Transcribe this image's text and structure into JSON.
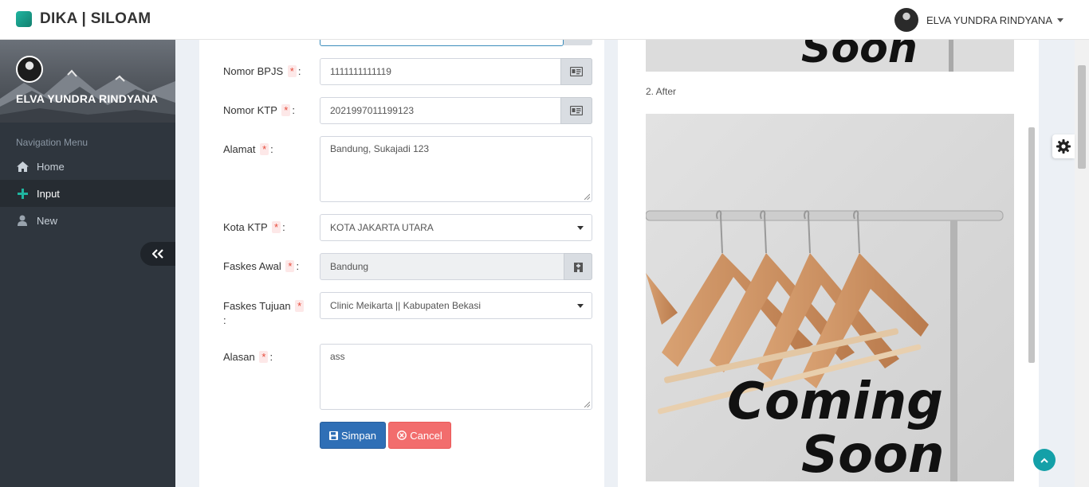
{
  "header": {
    "brand": "DIKA | SILOAM",
    "user_name": "ELVA YUNDRA RINDYANA"
  },
  "sidebar": {
    "user_name": "ELVA YUNDRA RINDYANA",
    "nav_title": "Navigation Menu",
    "items": [
      {
        "label": "Home",
        "icon": "home-icon"
      },
      {
        "label": "Input",
        "icon": "plus-icon",
        "active": true
      },
      {
        "label": "New",
        "icon": "user-icon"
      }
    ]
  },
  "form": {
    "required_mark": "*",
    "colon": ":",
    "bpjs": {
      "label": "Nomor BPJS",
      "value": "1111111111119"
    },
    "ktp": {
      "label": "Nomor KTP",
      "value": "2021997011199123"
    },
    "alamat": {
      "label": "Alamat",
      "value": "Bandung, Sukajadi 123"
    },
    "kota": {
      "label": "Kota KTP",
      "value": "KOTA JAKARTA UTARA"
    },
    "faskes_awal": {
      "label": "Faskes Awal",
      "value": "Bandung"
    },
    "faskes_tujuan": {
      "label": "Faskes Tujuan",
      "value": "Clinic Meikarta || Kabupaten Bekasi"
    },
    "alasan": {
      "label": "Alasan",
      "value": "ass"
    },
    "save_label": "Simpan",
    "cancel_label": "Cancel"
  },
  "preview": {
    "after_label": "2. After",
    "image_text_line1": "Coming",
    "image_text_line2": "Soon",
    "top_image_text": "Soon"
  },
  "colors": {
    "sidebar_bg": "#2f363e",
    "save_button": "#2f6fb6",
    "cancel_button": "#f26d6d",
    "brand_accent": "#1fb5a0"
  }
}
